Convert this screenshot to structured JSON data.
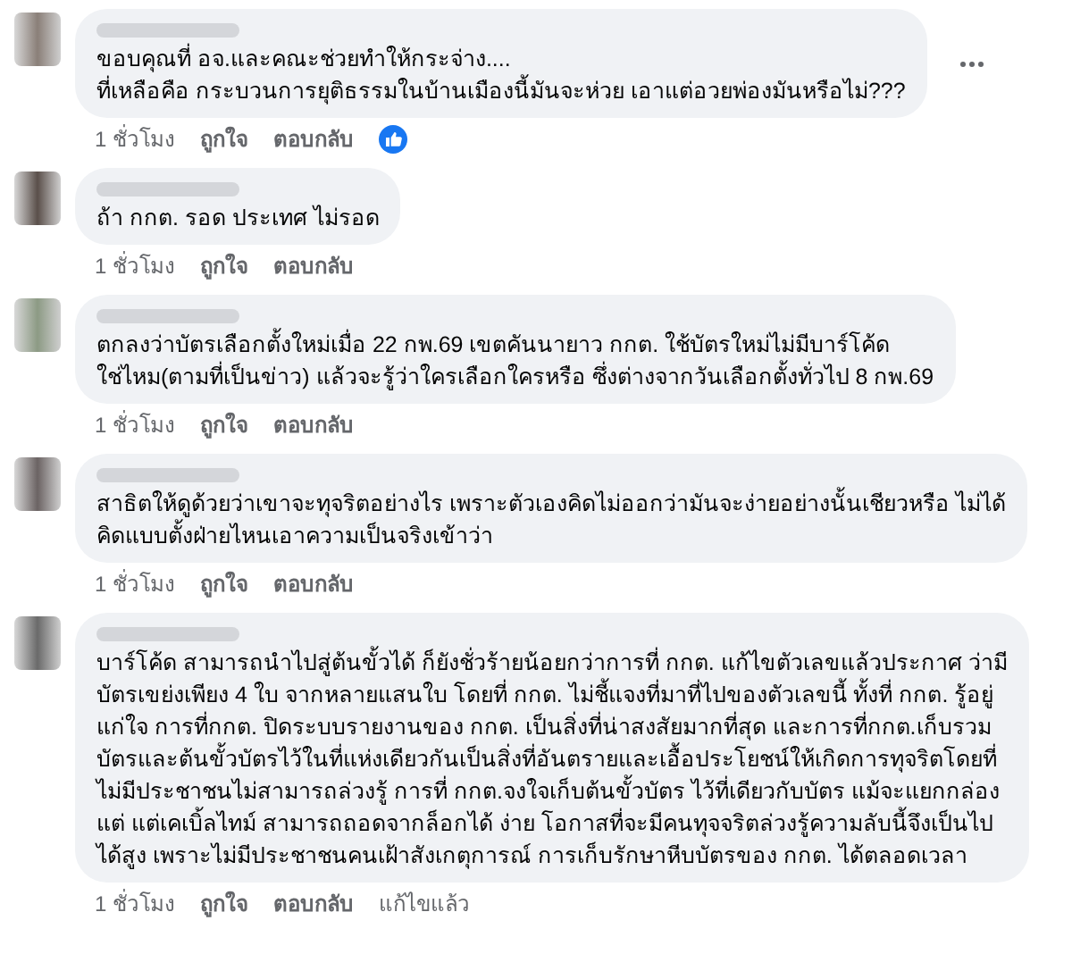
{
  "comments": [
    {
      "lines": [
        "ขอบคุณที่ อจ.และคณะช่วยทำให้กระจ่าง....",
        "ที่เหลือคือ กระบวนการยุติธรรมในบ้านเมืองนี้มันจะห่วย เอาแต่อวยพ่องมันหรือไม่???"
      ],
      "time": "1 ชั่วโมง",
      "like": "ถูกใจ",
      "reply": "ตอบกลับ",
      "reacted": true,
      "more": true
    },
    {
      "lines": [
        "ถ้า กกต. รอด ประเทศ ไม่รอด"
      ],
      "time": "1 ชั่วโมง",
      "like": "ถูกใจ",
      "reply": "ตอบกลับ",
      "reacted": false,
      "more": false
    },
    {
      "lines": [
        "ตกลงว่าบัตรเลือกตั้งใหม่เมื่อ 22 กพ.69 เขตคันนายาว กกต. ใช้บัตรใหม่ไม่มีบาร์โค้ด",
        "ใช่ไหม(ตามที่เป็นข่าว) แล้วจะรู้ว่าใครเลือกใครหรือ ซึ่งต่างจากวันเลือกตั้งทั่วไป 8 กพ.69"
      ],
      "time": "1 ชั่วโมง",
      "like": "ถูกใจ",
      "reply": "ตอบกลับ",
      "reacted": false,
      "more": false
    },
    {
      "lines": [
        "สาธิตให้ดูด้วยว่าเขาจะทุจริตอย่างไร เพราะตัวเองคิดไม่ออกว่ามันจะง่ายอย่างนั้นเชียวหรือ ไม่ได้",
        "คิดแบบตั้งฝ่ายไหนเอาความเป็นจริงเข้าว่า"
      ],
      "time": "1 ชั่วโมง",
      "like": "ถูกใจ",
      "reply": "ตอบกลับ",
      "reacted": false,
      "more": false
    },
    {
      "lines": [
        "บาร์โค้ด สามารถนำไปสู่ต้นขั้วได้ ก็ยังชั่วร้ายน้อยกว่าการที่ กกต. แก้ไขตัวเลขแล้วประกาศ ว่ามี",
        "บัตรเขย่งเพียง 4 ใบ จากหลายแสนใบ โดยที่ กกต. ไม่ชี้แจงที่มาที่ไปของตัวเลขนี้ ทั้งที่ กกต. รู้อยู่",
        "แก่ใจ การที่กกต. ปิดระบบรายงานของ กกต. เป็นสิ่งที่น่าสงสัยมากที่สุด และการที่กกต.เก็บรวม",
        "บัตรและต้นขั้วบัตรไว้ในที่แห่งเดียวกันเป็นสิ่งที่อันตรายและเอื้อประโยชน์ให้เกิดการทุจริตโดยที่",
        "ไม่มีประชาชนไม่สามารถล่วงรู้ การที่ กกต.จงใจเก็บต้นขั้วบัตร ไว้ที่เดียวกับบัตร แม้จะแยกกล่อง",
        "แต่ แต่เคเบิ้ลไทม์ สามารถถอดจากล็อกได้ ง่าย โอกาสที่จะมีคนทุจจริตล่วงรู้ความลับนี้จึงเป็นไป",
        "ได้สูง เพราะไม่มีประชาชนคนเฝ้าสังเกตุการณ์ การเก็บรักษาหีบบัตรของ กกต. ได้ตลอดเวลา"
      ],
      "time": "1 ชั่วโมง",
      "like": "ถูกใจ",
      "reply": "ตอบกลับ",
      "edited": "แก้ไขแล้ว",
      "reacted": false,
      "more": false
    }
  ]
}
